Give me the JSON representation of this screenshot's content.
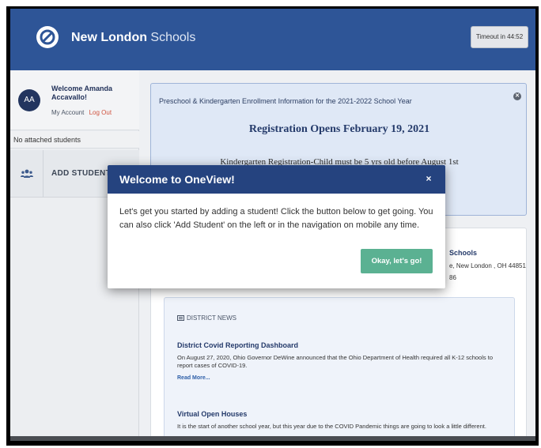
{
  "header": {
    "brand_bold": "New London",
    "brand_light": " Schools",
    "timeout_label": "Timeout in 44:52"
  },
  "sidebar": {
    "avatar_initials": "AA",
    "welcome_text": "Welcome Amanda Accavallo!",
    "my_account": "My Account",
    "log_out": "Log Out",
    "no_students": "No attached students",
    "add_student": "ADD STUDENT"
  },
  "announcement": {
    "intro": "Preschool & Kindergarten Enrollment Information for the 2021-2022 School Year",
    "heading": "Registration Opens February 19, 2021",
    "subtext": "Kindergarten Registration-Child must be 5 yrs old before August 1st"
  },
  "school": {
    "name": "Schools",
    "address": "e, New London , OH 44851",
    "phone": "86"
  },
  "news": {
    "section_label": "DISTRICT NEWS",
    "articles": [
      {
        "title": "District Covid Reporting Dashboard",
        "body": "On August 27, 2020, Ohio Governor DeWine announced that the Ohio Department of Health required all K-12 schools to report cases of COVID-19.",
        "read_more": "Read More..."
      },
      {
        "title": "Virtual Open Houses",
        "body": "It is the start of another school  year, but this year due to the COVID Pandemic things are going to look a little different."
      }
    ]
  },
  "modal": {
    "title": "Welcome to OneView!",
    "close_glyph": "×",
    "body": "Let's get you started by adding a student! Click the button below to get going. You can also click 'Add Student' on the left or in the navigation on mobile any time.",
    "ok_button": "Okay, let's go!"
  },
  "colors": {
    "header_blue": "#2e5597",
    "modal_header": "#25437f",
    "ok_green": "#5bb192",
    "logout_red": "#d0533f"
  }
}
